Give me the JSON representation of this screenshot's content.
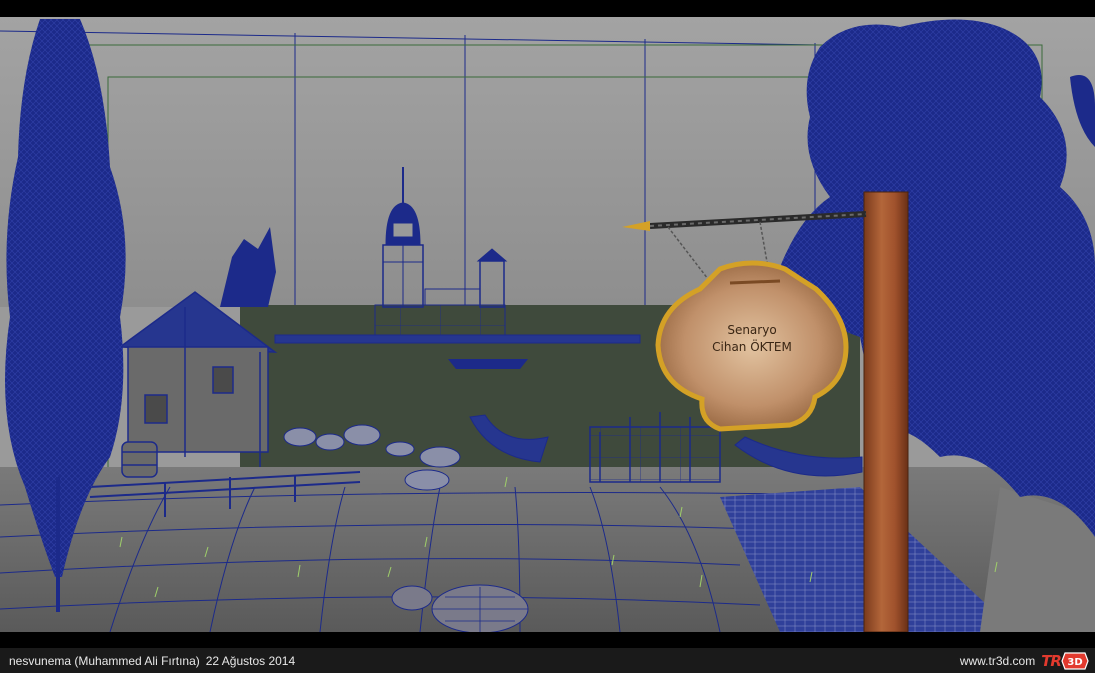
{
  "sign": {
    "line1": "Senaryo",
    "line2": "Cihan ÖKTEM"
  },
  "footer": {
    "credit": "nesvunema (Muhammed Ali Fırtına)",
    "date": "22 Ağustos 2014",
    "site": "www.tr3d.com",
    "logo_text": "TR",
    "logo_mark": "3D"
  },
  "colors": {
    "wireframe": "#1c2a8a",
    "sky": "#9a9a9a",
    "water": "#3f4a3c",
    "ground": "#6e6e6e",
    "logo_red": "#e23a2e",
    "sign_wood": "#b5825a",
    "sign_frame": "#d4a126",
    "post_wood": "#a0522d"
  }
}
